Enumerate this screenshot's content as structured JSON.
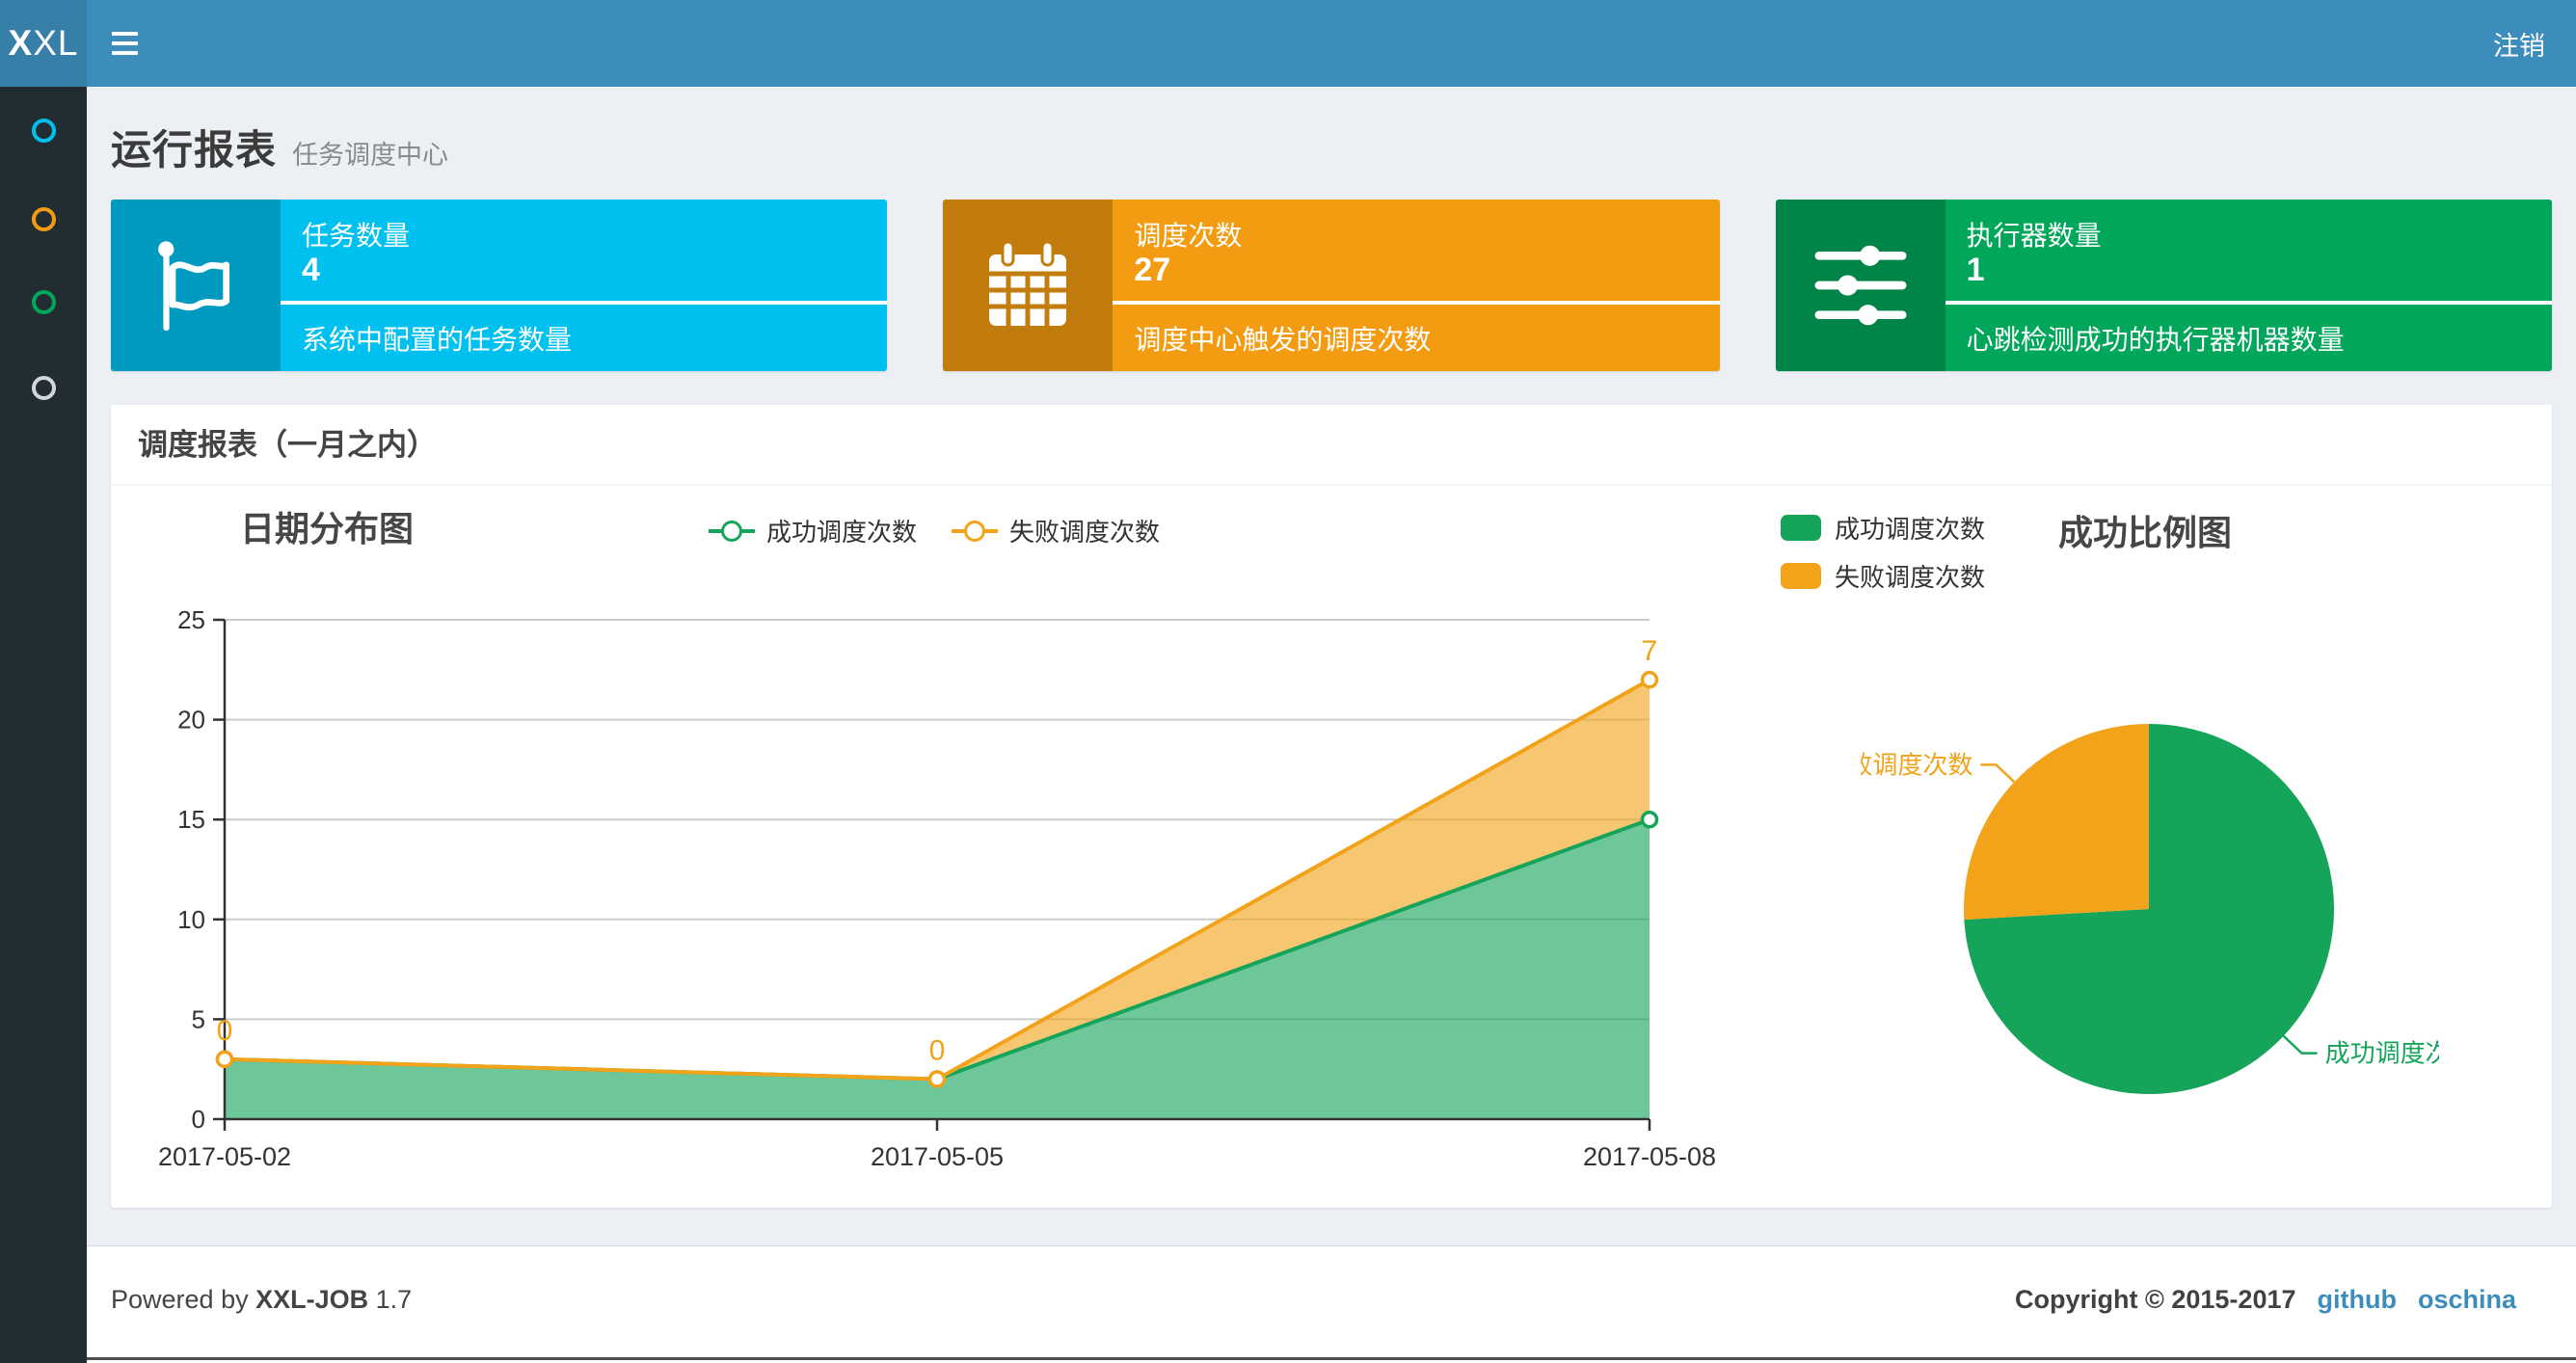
{
  "colors": {
    "navbar": "#3c8dbc",
    "logo_bg": "#367fa9",
    "sidebar_bg": "#222d32",
    "content_bg": "#ecf0f5",
    "card_aqua": "#00c0ef",
    "card_yellow": "#f39c12",
    "card_green": "#00a65a",
    "series_success": "#15a45a",
    "series_fail": "#f2a31a",
    "link": "#3c8dbc"
  },
  "navbar": {
    "logo_bold": "X",
    "logo_rest": "XL",
    "logout_label": "注销"
  },
  "sidebar": {
    "items": [
      {
        "name": "menu-dashboard",
        "ring_color": "#00c0ef"
      },
      {
        "name": "menu-job-manage",
        "ring_color": "#f39c12"
      },
      {
        "name": "menu-job-log",
        "ring_color": "#00a65a"
      },
      {
        "name": "menu-help",
        "ring_color": "#d2d6de"
      }
    ]
  },
  "page_header": {
    "title": "运行报表",
    "subtitle": "任务调度中心"
  },
  "stat_cards": [
    {
      "title": "任务数量",
      "value": "4",
      "desc": "系统中配置的任务数量",
      "color": "#00c0ef",
      "icon": "flag-icon"
    },
    {
      "title": "调度次数",
      "value": "27",
      "desc": "调度中心触发的调度次数",
      "color": "#f39c12",
      "icon": "calendar-icon"
    },
    {
      "title": "执行器数量",
      "value": "1",
      "desc": "心跳检测成功的执行器机器数量",
      "color": "#00a65a",
      "icon": "sliders-icon"
    }
  ],
  "report_panel": {
    "title": "调度报表（一月之内）"
  },
  "chart_data": [
    {
      "type": "area",
      "title": "日期分布图",
      "stacked": true,
      "grid": true,
      "legend_position": "top-center",
      "x": [
        "2017-05-02",
        "2017-05-05",
        "2017-05-08"
      ],
      "series": [
        {
          "name": "成功调度次数",
          "values": [
            3,
            2,
            15
          ],
          "color": "#15a45a"
        },
        {
          "name": "失败调度次数",
          "values": [
            0,
            0,
            7
          ],
          "color": "#f2a31a"
        }
      ],
      "point_labels": {
        "series": "失败调度次数",
        "values": [
          "0",
          "0",
          "7"
        ]
      },
      "ylabel": "",
      "xlabel": "",
      "ylim": [
        0,
        25
      ],
      "yticks": [
        0,
        5,
        10,
        15,
        20,
        25
      ]
    },
    {
      "type": "pie",
      "title": "成功比例图",
      "legend_position": "top-left",
      "slices": [
        {
          "name": "成功调度次数",
          "value": 20,
          "color": "#15a45a"
        },
        {
          "name": "失败调度次数",
          "value": 7,
          "color": "#f2a31a"
        }
      ]
    }
  ],
  "footer": {
    "powered_prefix": "Powered by",
    "product": "XXL-JOB",
    "version": "1.7",
    "copyright": "Copyright © 2015-2017",
    "links": [
      {
        "label": "github"
      },
      {
        "label": "oschina"
      }
    ]
  }
}
